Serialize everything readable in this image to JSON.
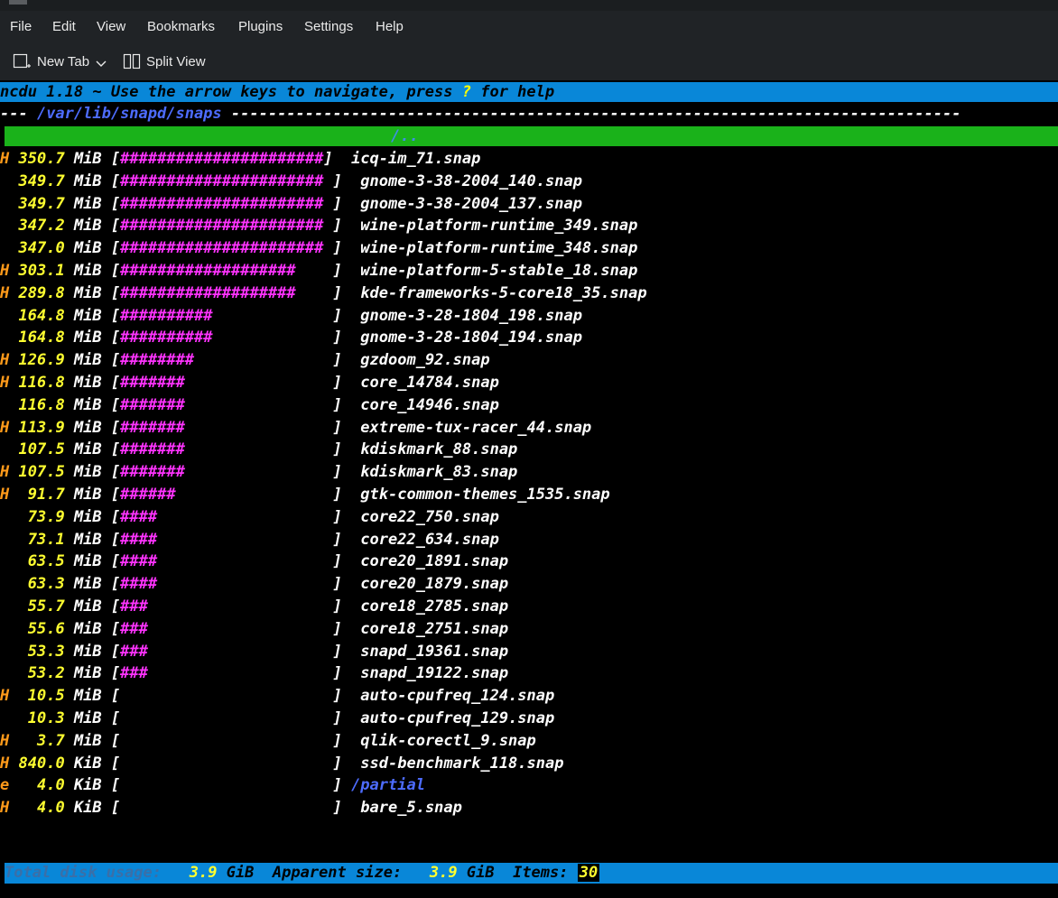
{
  "menubar": {
    "items": [
      "File",
      "Edit",
      "View",
      "Bookmarks",
      "Plugins",
      "Settings",
      "Help"
    ]
  },
  "toolbar": {
    "new_tab": "New Tab",
    "split_view": "Split View"
  },
  "terminal": {
    "header_pre": "ncdu 1.18 ~ Use the arrow keys to navigate, press ",
    "header_key": "?",
    "header_post": " for help",
    "path_prefix": "--- ",
    "path": "/var/lib/snapd/snaps",
    "path_suffix": " -------------------------------------------------------------------------------",
    "parent_entry": "/..",
    "rows": [
      {
        "flag": "H",
        "size": "350.7",
        "unit": "MiB",
        "bar": "######################",
        "name": "icq-im_71.snap",
        "dir": false
      },
      {
        "flag": " ",
        "size": "349.7",
        "unit": "MiB",
        "bar": "###################### ",
        "name": "gnome-3-38-2004_140.snap",
        "dir": false
      },
      {
        "flag": " ",
        "size": "349.7",
        "unit": "MiB",
        "bar": "###################### ",
        "name": "gnome-3-38-2004_137.snap",
        "dir": false
      },
      {
        "flag": " ",
        "size": "347.2",
        "unit": "MiB",
        "bar": "###################### ",
        "name": "wine-platform-runtime_349.snap",
        "dir": false
      },
      {
        "flag": " ",
        "size": "347.0",
        "unit": "MiB",
        "bar": "###################### ",
        "name": "wine-platform-runtime_348.snap",
        "dir": false
      },
      {
        "flag": "H",
        "size": "303.1",
        "unit": "MiB",
        "bar": "###################    ",
        "name": "wine-platform-5-stable_18.snap",
        "dir": false
      },
      {
        "flag": "H",
        "size": "289.8",
        "unit": "MiB",
        "bar": "###################    ",
        "name": "kde-frameworks-5-core18_35.snap",
        "dir": false
      },
      {
        "flag": " ",
        "size": "164.8",
        "unit": "MiB",
        "bar": "##########             ",
        "name": "gnome-3-28-1804_198.snap",
        "dir": false
      },
      {
        "flag": " ",
        "size": "164.8",
        "unit": "MiB",
        "bar": "##########             ",
        "name": "gnome-3-28-1804_194.snap",
        "dir": false
      },
      {
        "flag": "H",
        "size": "126.9",
        "unit": "MiB",
        "bar": "########               ",
        "name": "gzdoom_92.snap",
        "dir": false
      },
      {
        "flag": "H",
        "size": "116.8",
        "unit": "MiB",
        "bar": "#######                ",
        "name": "core_14784.snap",
        "dir": false
      },
      {
        "flag": " ",
        "size": "116.8",
        "unit": "MiB",
        "bar": "#######                ",
        "name": "core_14946.snap",
        "dir": false
      },
      {
        "flag": "H",
        "size": "113.9",
        "unit": "MiB",
        "bar": "#######                ",
        "name": "extreme-tux-racer_44.snap",
        "dir": false
      },
      {
        "flag": " ",
        "size": "107.5",
        "unit": "MiB",
        "bar": "#######                ",
        "name": "kdiskmark_88.snap",
        "dir": false
      },
      {
        "flag": "H",
        "size": "107.5",
        "unit": "MiB",
        "bar": "#######                ",
        "name": "kdiskmark_83.snap",
        "dir": false
      },
      {
        "flag": "H",
        "size": " 91.7",
        "unit": "MiB",
        "bar": "######                 ",
        "name": "gtk-common-themes_1535.snap",
        "dir": false
      },
      {
        "flag": " ",
        "size": " 73.9",
        "unit": "MiB",
        "bar": "####                   ",
        "name": "core22_750.snap",
        "dir": false
      },
      {
        "flag": " ",
        "size": " 73.1",
        "unit": "MiB",
        "bar": "####                   ",
        "name": "core22_634.snap",
        "dir": false
      },
      {
        "flag": " ",
        "size": " 63.5",
        "unit": "MiB",
        "bar": "####                   ",
        "name": "core20_1891.snap",
        "dir": false
      },
      {
        "flag": " ",
        "size": " 63.3",
        "unit": "MiB",
        "bar": "####                   ",
        "name": "core20_1879.snap",
        "dir": false
      },
      {
        "flag": " ",
        "size": " 55.7",
        "unit": "MiB",
        "bar": "###                    ",
        "name": "core18_2785.snap",
        "dir": false
      },
      {
        "flag": " ",
        "size": " 55.6",
        "unit": "MiB",
        "bar": "###                    ",
        "name": "core18_2751.snap",
        "dir": false
      },
      {
        "flag": " ",
        "size": " 53.3",
        "unit": "MiB",
        "bar": "###                    ",
        "name": "snapd_19361.snap",
        "dir": false
      },
      {
        "flag": " ",
        "size": " 53.2",
        "unit": "MiB",
        "bar": "###                    ",
        "name": "snapd_19122.snap",
        "dir": false
      },
      {
        "flag": "H",
        "size": " 10.5",
        "unit": "MiB",
        "bar": "                       ",
        "name": "auto-cpufreq_124.snap",
        "dir": false
      },
      {
        "flag": " ",
        "size": " 10.3",
        "unit": "MiB",
        "bar": "                       ",
        "name": "auto-cpufreq_129.snap",
        "dir": false
      },
      {
        "flag": "H",
        "size": "  3.7",
        "unit": "MiB",
        "bar": "                       ",
        "name": "qlik-corectl_9.snap",
        "dir": false
      },
      {
        "flag": "H",
        "size": "840.0",
        "unit": "KiB",
        "bar": "                       ",
        "name": "ssd-benchmark_118.snap",
        "dir": false
      },
      {
        "flag": "e",
        "size": "  4.0",
        "unit": "KiB",
        "bar": "                       ",
        "name": "/partial",
        "dir": true
      },
      {
        "flag": "H",
        "size": "  4.0",
        "unit": "KiB",
        "bar": "                       ",
        "name": "bare_5.snap",
        "dir": false
      }
    ],
    "status": {
      "total_label": "Total disk usage:",
      "total_value": "3.9",
      "total_unit": "GiB",
      "apparent_label": "Apparent size:",
      "apparent_value": "3.9",
      "apparent_unit": "GiB",
      "items_label": "Items:",
      "items_value": "30"
    }
  },
  "colors": {
    "header_bg": "#0987d8",
    "selection_bg": "#1ab21a",
    "flag": "#ff9a1a",
    "size": "#ffff30",
    "bar": "#ff33ff",
    "dir": "#4d6cff"
  }
}
